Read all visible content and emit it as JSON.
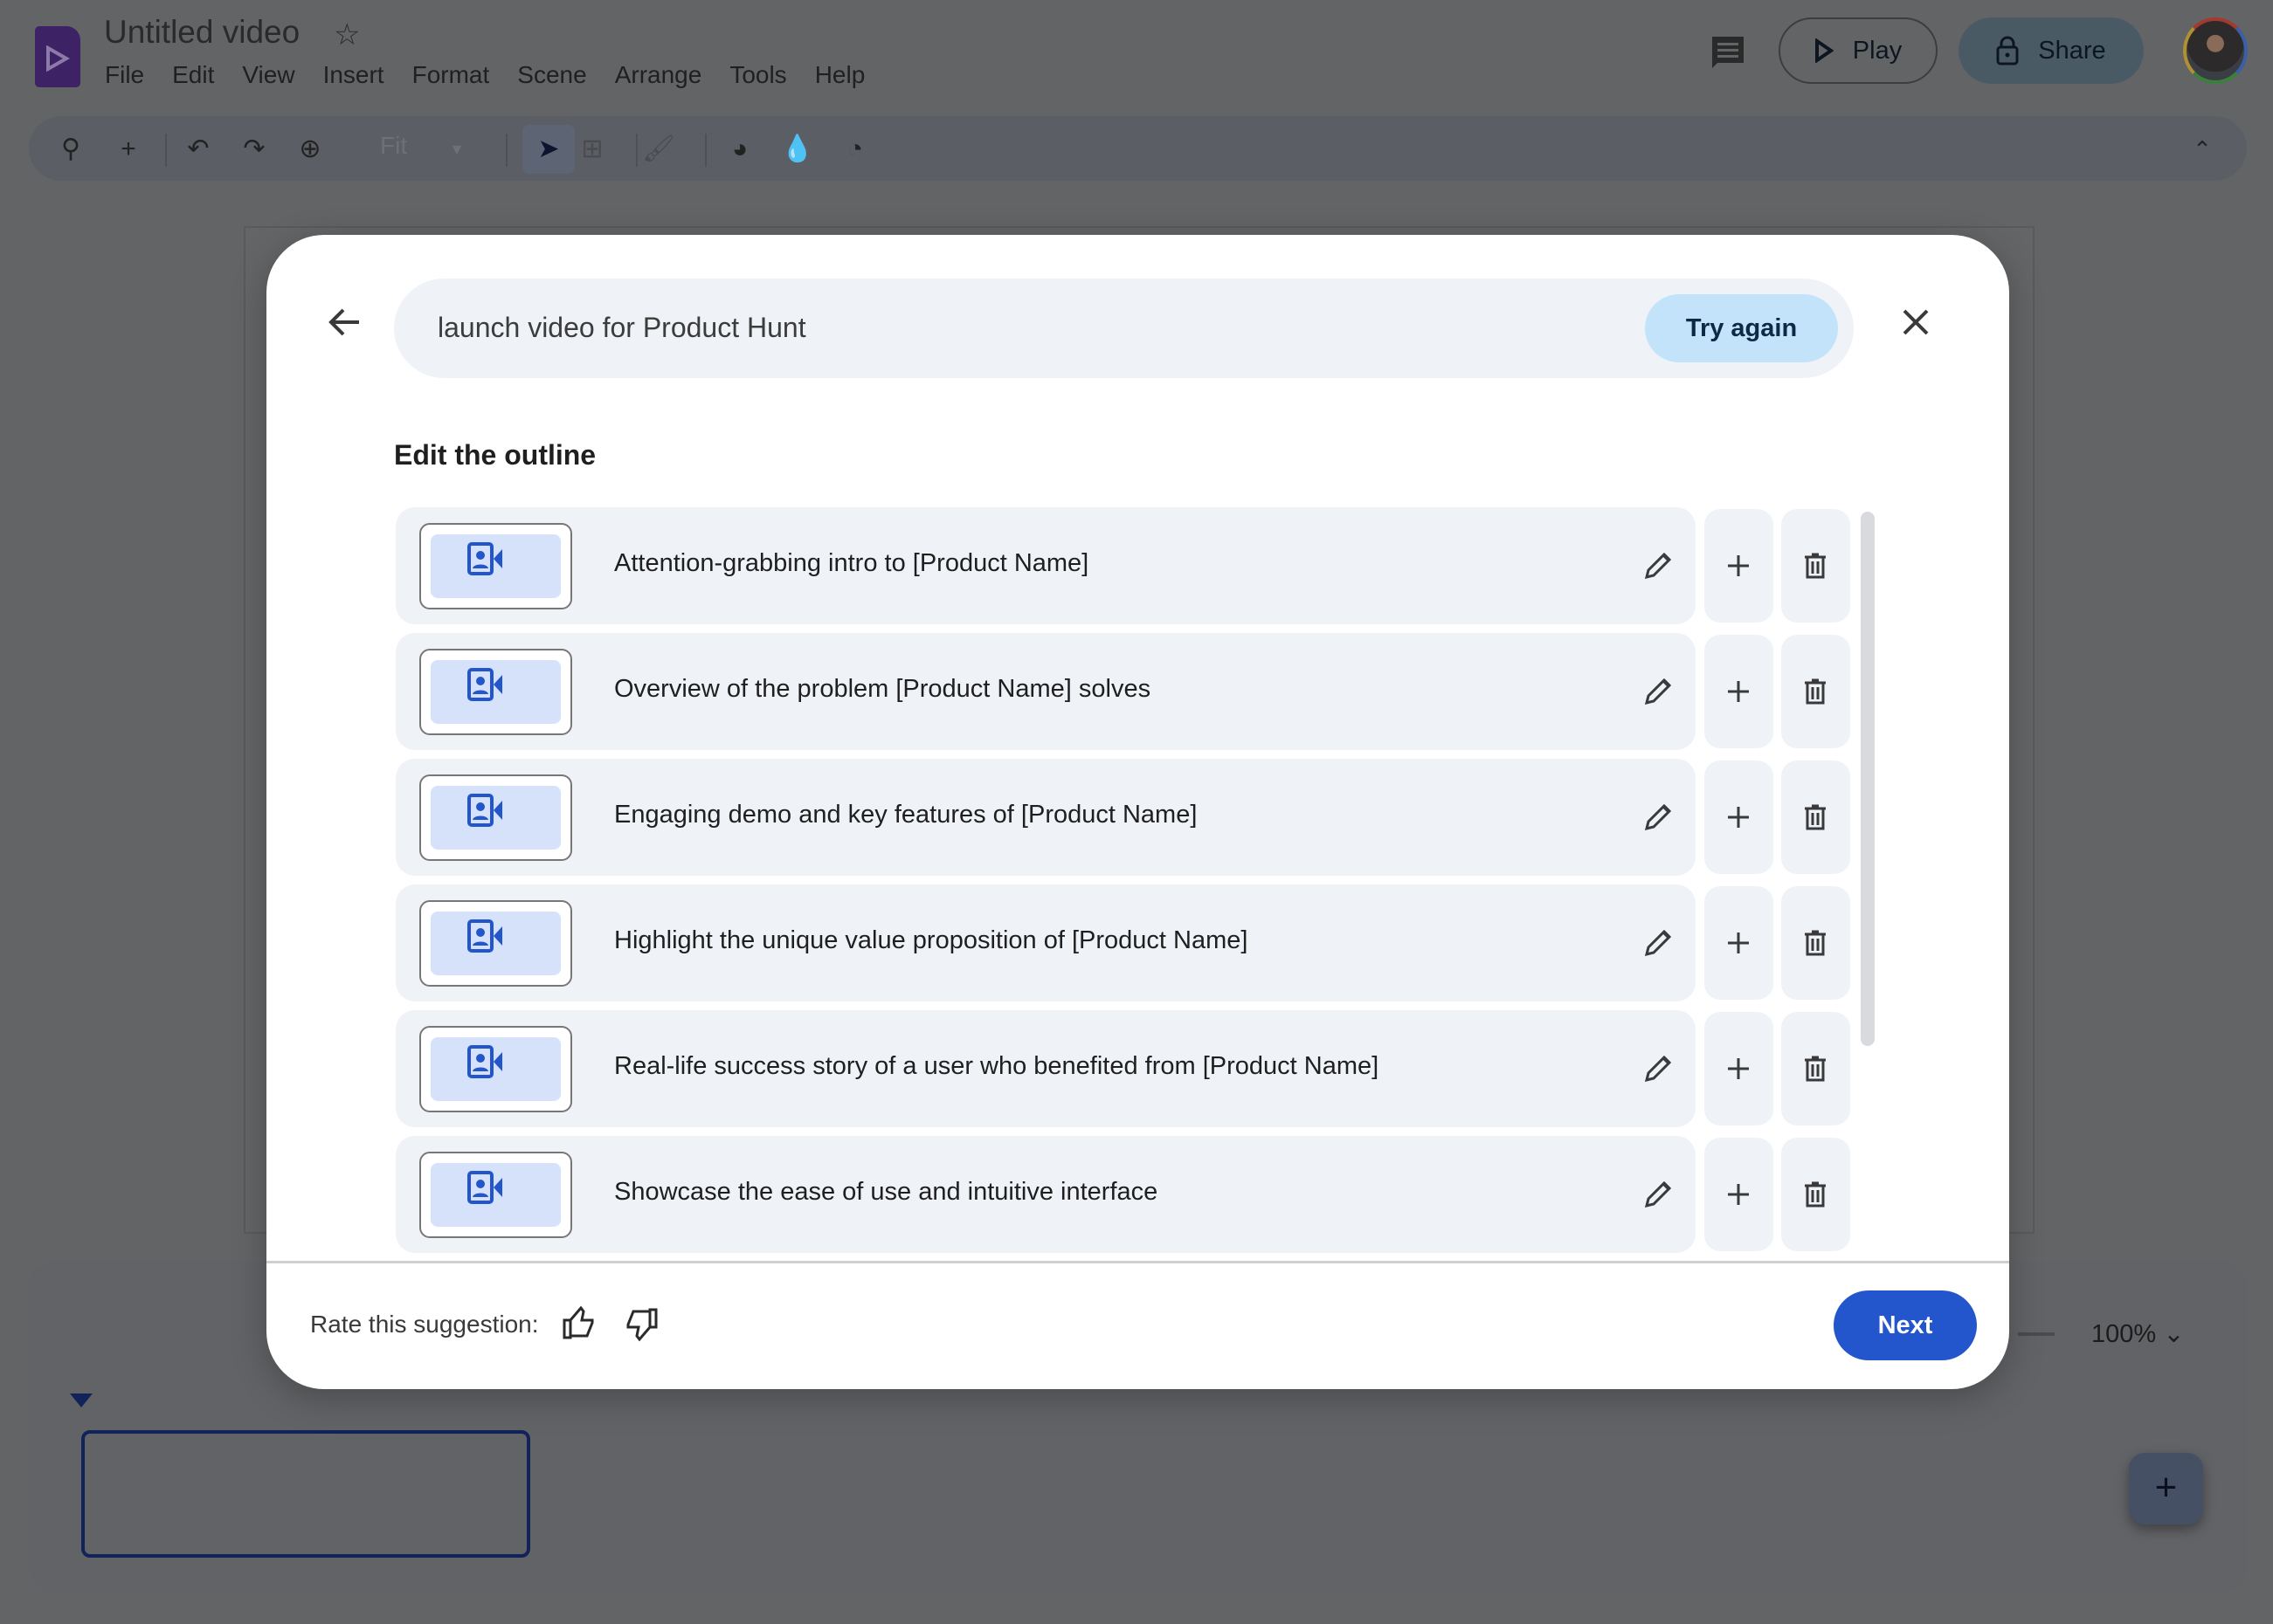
{
  "app": {
    "title": "Untitled video",
    "menu": [
      "File",
      "Edit",
      "View",
      "Insert",
      "Format",
      "Scene",
      "Arrange",
      "Tools",
      "Help"
    ],
    "toolbar": {
      "zoom_value": "Fit"
    },
    "play_label": "Play",
    "share_label": "Share",
    "zoom_percent": "100%"
  },
  "dialog": {
    "prompt": "launch video for Product Hunt",
    "try_again": "Try again",
    "heading": "Edit the outline",
    "outline": [
      {
        "text": "Attention-grabbing intro to [Product Name]"
      },
      {
        "text": "Overview of the problem [Product Name] solves"
      },
      {
        "text": "Engaging demo and key features of [Product Name]"
      },
      {
        "text": "Highlight the unique value proposition of [Product Name]"
      },
      {
        "text": "Real-life success story of a user who benefited from [Product Name]"
      },
      {
        "text": "Showcase the ease of use and intuitive interface"
      }
    ],
    "rate_label": "Rate this suggestion:",
    "next_label": "Next"
  },
  "colors": {
    "accent": "#2356cc",
    "try_again_bg": "#c3e3fb",
    "row_bg": "#eff3f8",
    "thumb_bg": "#d6e2fa"
  }
}
